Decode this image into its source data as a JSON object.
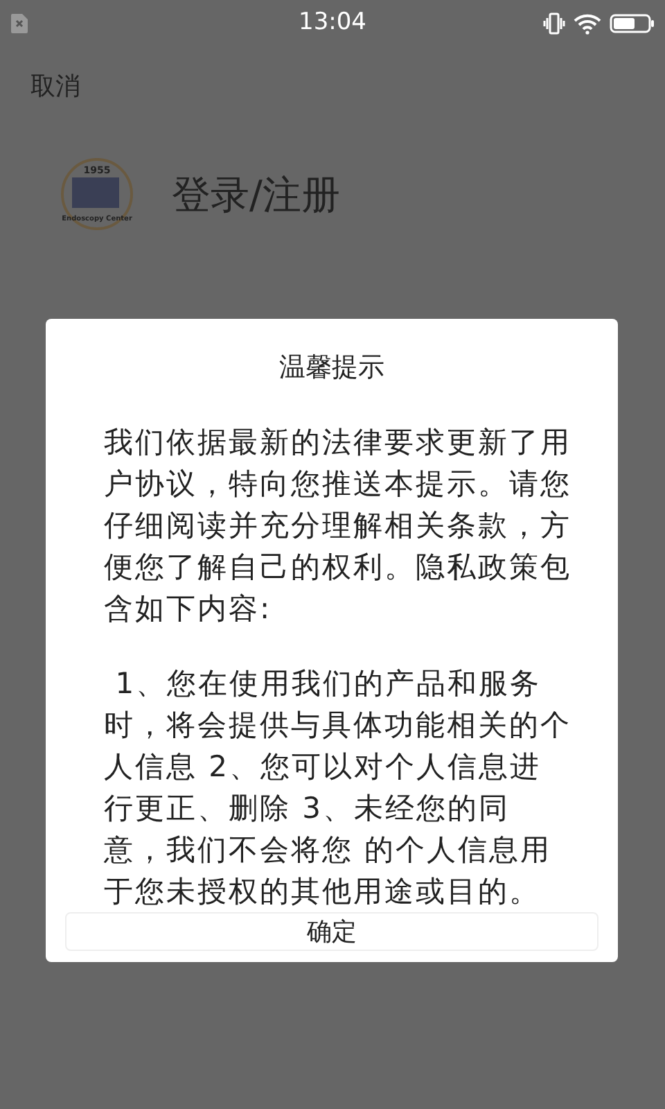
{
  "status_bar": {
    "time": "13:04"
  },
  "header": {
    "cancel": "取消"
  },
  "logo": {
    "year": "1955",
    "name": "Endoscopy Center"
  },
  "login_title": "登录/注册",
  "dialog": {
    "title": "温馨提示",
    "paragraphs": [
      "我们依据最新的法律要求更新了用户协议，特向您推送本提示。请您仔细阅读并充分理解相关条款，方便您了解自己的权利。隐私政策包含如下内容:",
      " 1、您在使用我们的产品和服务时，将会提供与具体功能相关的个人信息 2、您可以对个人信息进行更正、删除 3、未经您的同意，我们不会将您 的个人信息用于您未授权的其他用途或目的。"
    ],
    "confirm": "确定"
  }
}
